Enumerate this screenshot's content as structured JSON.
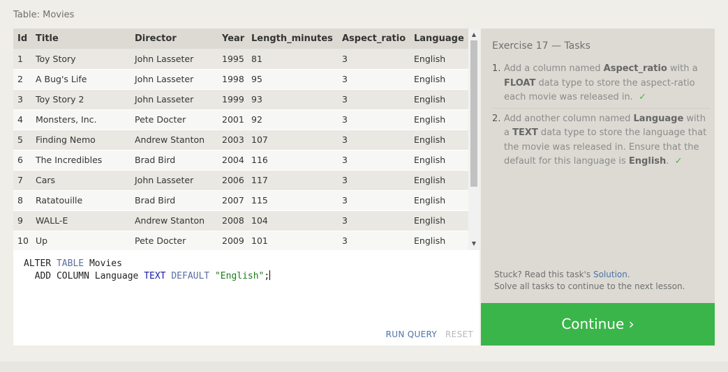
{
  "table_caption": "Table: Movies",
  "table": {
    "columns": [
      "Id",
      "Title",
      "Director",
      "Year",
      "Length_minutes",
      "Aspect_ratio",
      "Language"
    ],
    "rows": [
      [
        "1",
        "Toy Story",
        "John Lasseter",
        "1995",
        "81",
        "3",
        "English"
      ],
      [
        "2",
        "A Bug's Life",
        "John Lasseter",
        "1998",
        "95",
        "3",
        "English"
      ],
      [
        "3",
        "Toy Story 2",
        "John Lasseter",
        "1999",
        "93",
        "3",
        "English"
      ],
      [
        "4",
        "Monsters, Inc.",
        "Pete Docter",
        "2001",
        "92",
        "3",
        "English"
      ],
      [
        "5",
        "Finding Nemo",
        "Andrew Stanton",
        "2003",
        "107",
        "3",
        "English"
      ],
      [
        "6",
        "The Incredibles",
        "Brad Bird",
        "2004",
        "116",
        "3",
        "English"
      ],
      [
        "7",
        "Cars",
        "John Lasseter",
        "2006",
        "117",
        "3",
        "English"
      ],
      [
        "8",
        "Ratatouille",
        "Brad Bird",
        "2007",
        "115",
        "3",
        "English"
      ],
      [
        "9",
        "WALL-E",
        "Andrew Stanton",
        "2008",
        "104",
        "3",
        "English"
      ],
      [
        "10",
        "Up",
        "Pete Docter",
        "2009",
        "101",
        "3",
        "English"
      ]
    ]
  },
  "editor": {
    "line1_kw1": "ALTER",
    "line1_kw2": "TABLE",
    "line1_rest": "Movies",
    "line2_lead": "ADD COLUMN Language",
    "line2_type": "TEXT",
    "line2_kw": "DEFAULT",
    "line2_str": "\"English\"",
    "line2_end": ";",
    "run_label": "RUN QUERY",
    "reset_label": "RESET"
  },
  "tasks": {
    "title": "Exercise 17 — Tasks",
    "items": [
      {
        "num": "1.",
        "t1": "Add a column named ",
        "b1": "Aspect_ratio",
        "t2": " with a ",
        "b2": "FLOAT",
        "t3": " data type to store the aspect-ratio each movie was released in.",
        "check": "✓"
      },
      {
        "num": "2.",
        "t1": "Add another column named ",
        "b1": "Language",
        "t2": " with a ",
        "b2": "TEXT",
        "t3": " data type to store the language that the movie was released in. Ensure that the default for this language is ",
        "b3": "English",
        "t4": ".",
        "check": "✓"
      }
    ],
    "stuck_prefix": "Stuck? Read this task's ",
    "solution_link": "Solution",
    "stuck_suffix": ".",
    "solve_all": "Solve all tasks to continue to the next lesson."
  },
  "continue_label": "Continue ›",
  "icons": {
    "scroll_up": "▲",
    "scroll_down": "▼"
  },
  "colors": {
    "continue": "#3ab54a",
    "link": "#4a72a8",
    "check": "#4db34d"
  }
}
